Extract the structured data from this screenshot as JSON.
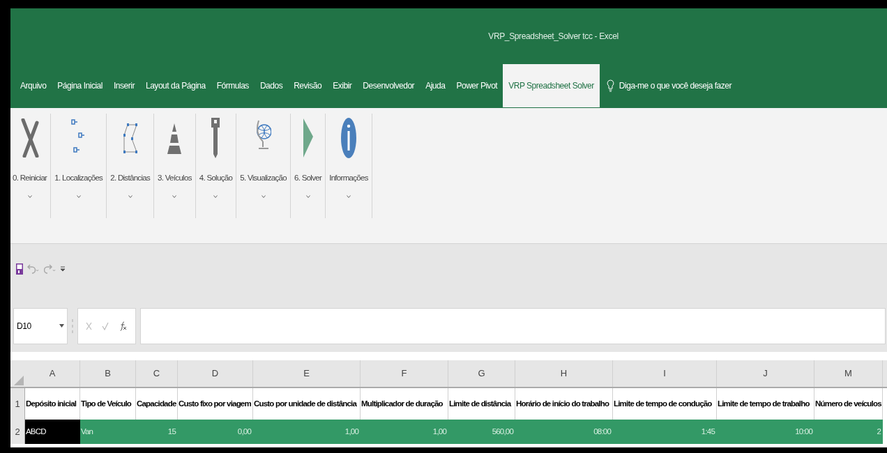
{
  "window": {
    "title": "VRP_Spreadsheet_Solver tcc  -  Excel"
  },
  "tabs": [
    {
      "label": "Arquivo",
      "selected": false
    },
    {
      "label": "Página Inicial",
      "selected": false
    },
    {
      "label": "Inserir",
      "selected": false
    },
    {
      "label": "Layout da Página",
      "selected": false
    },
    {
      "label": "Fórmulas",
      "selected": false
    },
    {
      "label": "Dados",
      "selected": false
    },
    {
      "label": "Revisão",
      "selected": false
    },
    {
      "label": "Exibir",
      "selected": false
    },
    {
      "label": "Desenvolvedor",
      "selected": false
    },
    {
      "label": "Ajuda",
      "selected": false
    },
    {
      "label": "Power Pivot",
      "selected": false
    },
    {
      "label": "VRP Spreadsheet Solver",
      "selected": true
    }
  ],
  "tell_me": {
    "placeholder": "Diga-me o que você deseja fazer"
  },
  "ribbon": [
    {
      "kind": "reset",
      "label": "0. Reiniciar"
    },
    {
      "kind": "locations",
      "label": "1. Localizações"
    },
    {
      "kind": "distances",
      "label": "2. Distâncias"
    },
    {
      "kind": "vehicles",
      "label": "3. Veículos"
    },
    {
      "kind": "solution",
      "label": "4. Solução"
    },
    {
      "kind": "visualization",
      "label": "5. Visualização"
    },
    {
      "kind": "solver",
      "label": "6. Solver"
    },
    {
      "kind": "info",
      "label": "Informações"
    }
  ],
  "name_box": {
    "value": "D10"
  },
  "sheet": {
    "columns": [
      "A",
      "B",
      "C",
      "D",
      "E",
      "F",
      "G",
      "H",
      "I",
      "J",
      "M"
    ],
    "rows": [
      {
        "number": "1",
        "kind": "header",
        "cells": [
          "Depósito inicial",
          "Tipo de Veículo",
          "Capacidade",
          "Custo fixo por viagem",
          "Custo por unidade de distância",
          "Multiplicador de duração",
          "Limite de distância",
          "Horário de início do trabalho",
          "Limite de tempo de condução",
          "Limite de tempo de trabalho",
          "Número de veículos"
        ]
      },
      {
        "number": "2",
        "kind": "data",
        "cells": [
          "ABCD",
          "Van",
          "15",
          "0,00",
          "1,00",
          "1,00",
          "560,00",
          "08:00",
          "1:45",
          "10:00",
          "2"
        ]
      }
    ]
  }
}
